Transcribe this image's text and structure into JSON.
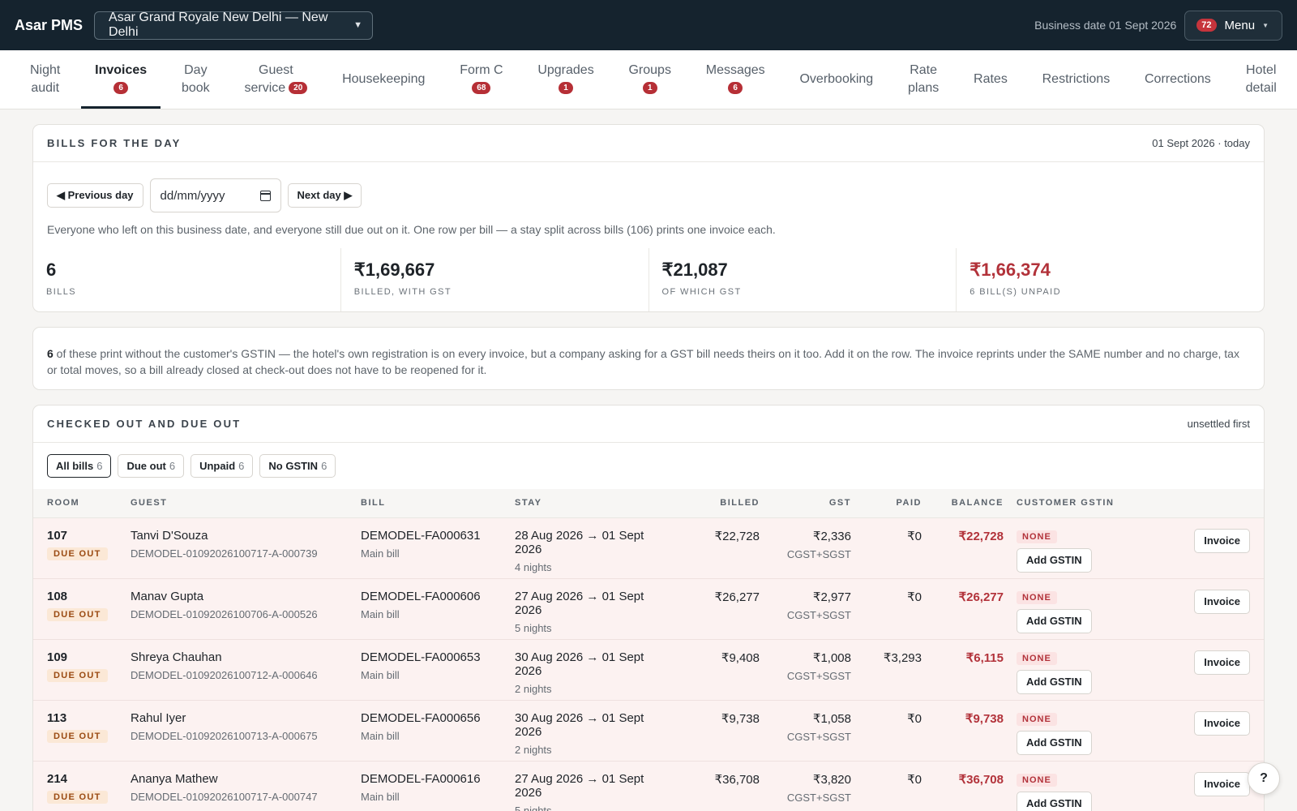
{
  "app": {
    "brand": "Asar PMS",
    "property": "Asar Grand Royale New Delhi — New Delhi",
    "business_date": "Business date 01 Sept 2026",
    "menu_badge": "72",
    "menu_label": "Menu"
  },
  "nav": [
    {
      "line1": "Night",
      "line2": "audit",
      "badge": ""
    },
    {
      "line1": "Invoices",
      "line2": "",
      "badge": "6",
      "active": true
    },
    {
      "line1": "Day",
      "line2": "book",
      "badge": ""
    },
    {
      "line1": "Guest",
      "line2": "service",
      "badge": "20"
    },
    {
      "line1": "Housekeeping",
      "line2": "",
      "badge": ""
    },
    {
      "line1": "Form C",
      "line2": "",
      "badge": "68"
    },
    {
      "line1": "Upgrades",
      "line2": "",
      "badge": "1"
    },
    {
      "line1": "Groups",
      "line2": "",
      "badge": "1"
    },
    {
      "line1": "Messages",
      "line2": "",
      "badge": "6"
    },
    {
      "line1": "Overbooking",
      "line2": "",
      "badge": ""
    },
    {
      "line1": "Rate",
      "line2": "plans",
      "badge": ""
    },
    {
      "line1": "Rates",
      "line2": "",
      "badge": ""
    },
    {
      "line1": "Restrictions",
      "line2": "",
      "badge": ""
    },
    {
      "line1": "Corrections",
      "line2": "",
      "badge": ""
    },
    {
      "line1": "Hotel",
      "line2": "detail",
      "badge": ""
    }
  ],
  "bills_card": {
    "title": "BILLS FOR THE DAY",
    "meta": "01 Sept 2026 · today",
    "prev_label": "◀ Previous day",
    "next_label": "Next day ▶",
    "date_placeholder": "dd/mm/yyyy",
    "description": "Everyone who left on this business date, and everyone still due out on it. One row per bill — a stay split across bills (106) prints one invoice each.",
    "stats": [
      {
        "value": "6",
        "label": "BILLS",
        "red": false
      },
      {
        "value": "₹1,69,667",
        "label": "BILLED, WITH GST",
        "red": false
      },
      {
        "value": "₹21,087",
        "label": "OF WHICH GST",
        "red": false
      },
      {
        "value": "₹1,66,374",
        "label": "6 BILL(S) UNPAID",
        "red": true
      }
    ]
  },
  "gstin_note": {
    "count": "6",
    "text": " of these print without the customer's GSTIN — the hotel's own registration is on every invoice, but a company asking for a GST bill needs theirs on it too. Add it on the row. The invoice reprints under the SAME number and no charge, tax or total moves, so a bill already closed at check-out does not have to be reopened for it."
  },
  "list_card": {
    "title": "CHECKED OUT AND DUE OUT",
    "meta": "unsettled first",
    "filters": [
      {
        "label": "All bills",
        "count": "6",
        "active": true
      },
      {
        "label": "Due out",
        "count": "6",
        "active": false
      },
      {
        "label": "Unpaid",
        "count": "6",
        "active": false
      },
      {
        "label": "No GSTIN",
        "count": "6",
        "active": false
      }
    ],
    "columns": [
      "ROOM",
      "GUEST",
      "BILL",
      "STAY",
      "BILLED",
      "GST",
      "PAID",
      "BALANCE",
      "CUSTOMER GSTIN",
      ""
    ],
    "rows": [
      {
        "room": "107",
        "status": "DUE OUT",
        "guest": "Tanvi D'Souza",
        "guest_id": "DEMODEL-01092026100717-A-000739",
        "bill": "DEMODEL-FA000631",
        "bill_type": "Main bill",
        "stay": "28 Aug 2026 → 01 Sept 2026",
        "nights": "4 nights",
        "billed": "₹22,728",
        "gst": "₹2,336",
        "gst_type": "CGST+SGST",
        "paid": "₹0",
        "balance": "₹22,728",
        "gstin": "NONE",
        "add_label": "Add GSTIN",
        "invoice_label": "Invoice"
      },
      {
        "room": "108",
        "status": "DUE OUT",
        "guest": "Manav Gupta",
        "guest_id": "DEMODEL-01092026100706-A-000526",
        "bill": "DEMODEL-FA000606",
        "bill_type": "Main bill",
        "stay": "27 Aug 2026 → 01 Sept 2026",
        "nights": "5 nights",
        "billed": "₹26,277",
        "gst": "₹2,977",
        "gst_type": "CGST+SGST",
        "paid": "₹0",
        "balance": "₹26,277",
        "gstin": "NONE",
        "add_label": "Add GSTIN",
        "invoice_label": "Invoice"
      },
      {
        "room": "109",
        "status": "DUE OUT",
        "guest": "Shreya Chauhan",
        "guest_id": "DEMODEL-01092026100712-A-000646",
        "bill": "DEMODEL-FA000653",
        "bill_type": "Main bill",
        "stay": "30 Aug 2026 → 01 Sept 2026",
        "nights": "2 nights",
        "billed": "₹9,408",
        "gst": "₹1,008",
        "gst_type": "CGST+SGST",
        "paid": "₹3,293",
        "balance": "₹6,115",
        "gstin": "NONE",
        "add_label": "Add GSTIN",
        "invoice_label": "Invoice"
      },
      {
        "room": "113",
        "status": "DUE OUT",
        "guest": "Rahul Iyer",
        "guest_id": "DEMODEL-01092026100713-A-000675",
        "bill": "DEMODEL-FA000656",
        "bill_type": "Main bill",
        "stay": "30 Aug 2026 → 01 Sept 2026",
        "nights": "2 nights",
        "billed": "₹9,738",
        "gst": "₹1,058",
        "gst_type": "CGST+SGST",
        "paid": "₹0",
        "balance": "₹9,738",
        "gstin": "NONE",
        "add_label": "Add GSTIN",
        "invoice_label": "Invoice"
      },
      {
        "room": "214",
        "status": "DUE OUT",
        "guest": "Ananya Mathew",
        "guest_id": "DEMODEL-01092026100717-A-000747",
        "bill": "DEMODEL-FA000616",
        "bill_type": "Main bill",
        "stay": "27 Aug 2026 → 01 Sept 2026",
        "nights": "5 nights",
        "billed": "₹36,708",
        "gst": "₹3,820",
        "gst_type": "CGST+SGST",
        "paid": "₹0",
        "balance": "₹36,708",
        "gstin": "NONE",
        "add_label": "Add GSTIN",
        "invoice_label": "Invoice"
      }
    ]
  },
  "help_label": "?"
}
